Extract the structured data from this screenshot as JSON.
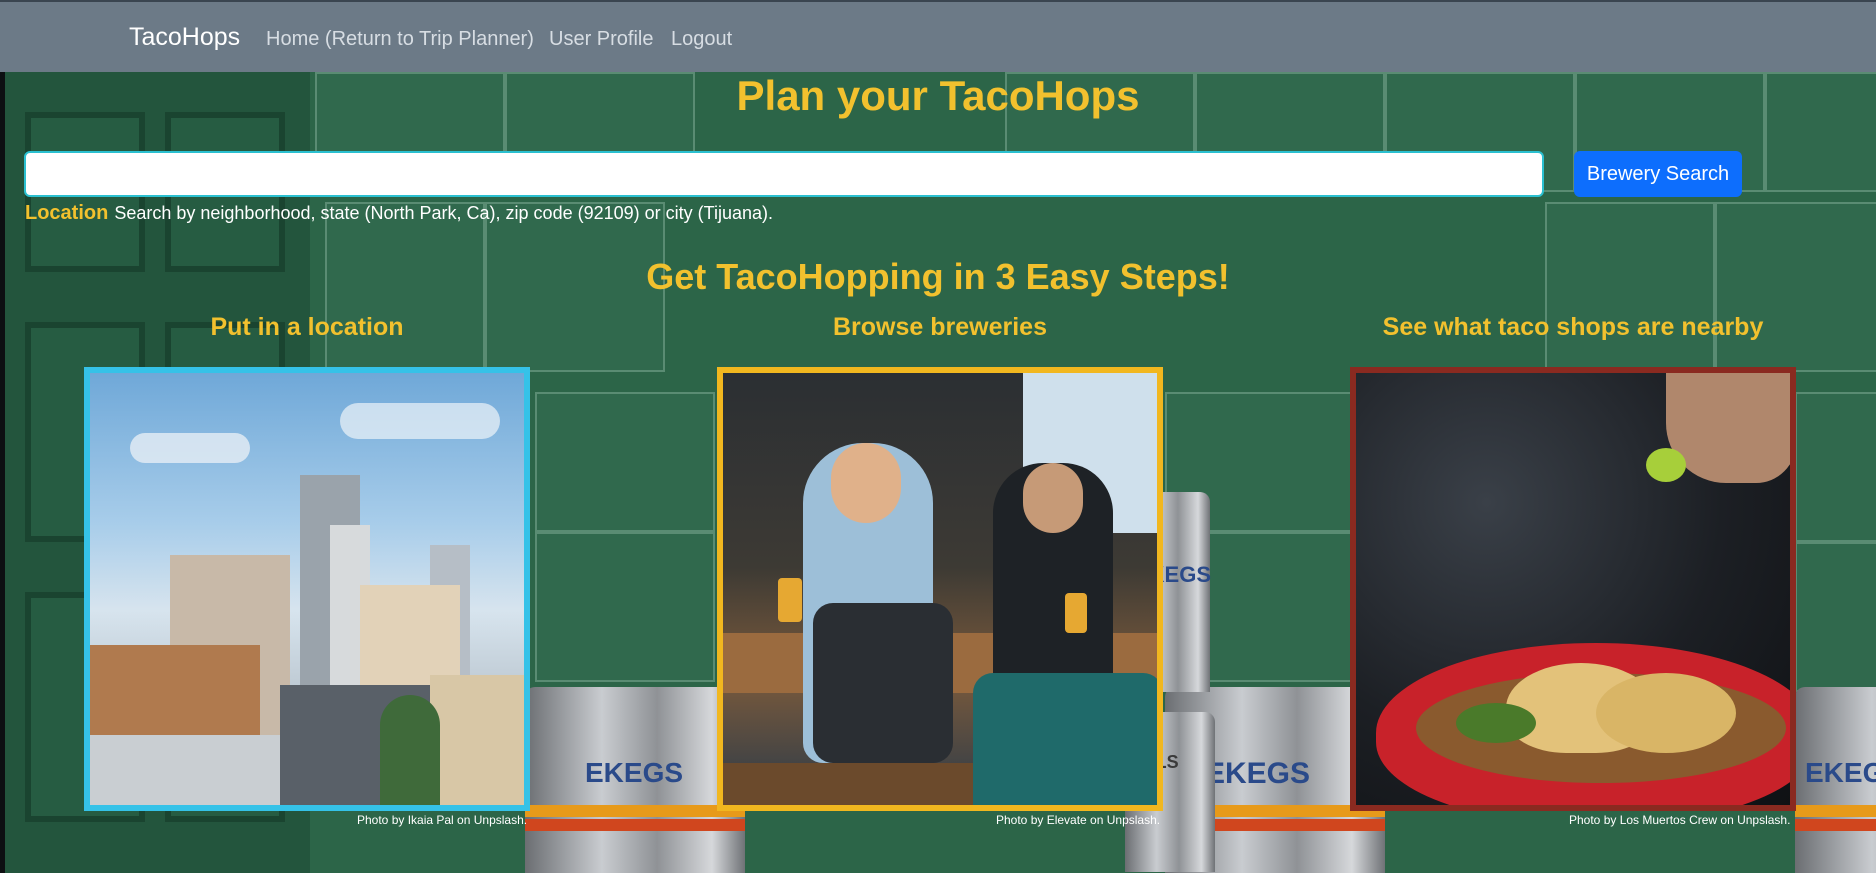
{
  "navbar": {
    "brand": "TacoHops",
    "links": [
      {
        "label": "Home (Return to Trip Planner)"
      },
      {
        "label": "User Profile"
      },
      {
        "label": "Logout"
      }
    ]
  },
  "search": {
    "title": "Plan your TacoHops",
    "input_value": "",
    "placeholder": "",
    "button_label": "Brewery Search",
    "help_label": "Location",
    "help_text": "Search by neighborhood, state (North Park, Ca), zip code (92109) or city (Tijuana)."
  },
  "steps": {
    "title": "Get TacoHopping in 3 Easy Steps!",
    "items": [
      {
        "title": "Put in a location",
        "credit": "Photo by Ikaia Pal on Unpslash."
      },
      {
        "title": "Browse breweries",
        "credit": "Photo by Elevate on Unpslash."
      },
      {
        "title": "See what taco shops are nearby",
        "credit": "Photo by Los Muertos Crew on Unpslash."
      }
    ]
  },
  "background": {
    "keg_labels": [
      "EKEGS",
      "EKEGS",
      "EKEGS",
      "TALS",
      "EKEGS"
    ]
  },
  "colors": {
    "navbar": "#6c7a87",
    "accent_yellow": "#f2c12e",
    "button_blue": "#0d6efd",
    "card1_border": "#35c2e8",
    "card2_border": "#f1b71f",
    "card3_border": "#8a2a20"
  }
}
